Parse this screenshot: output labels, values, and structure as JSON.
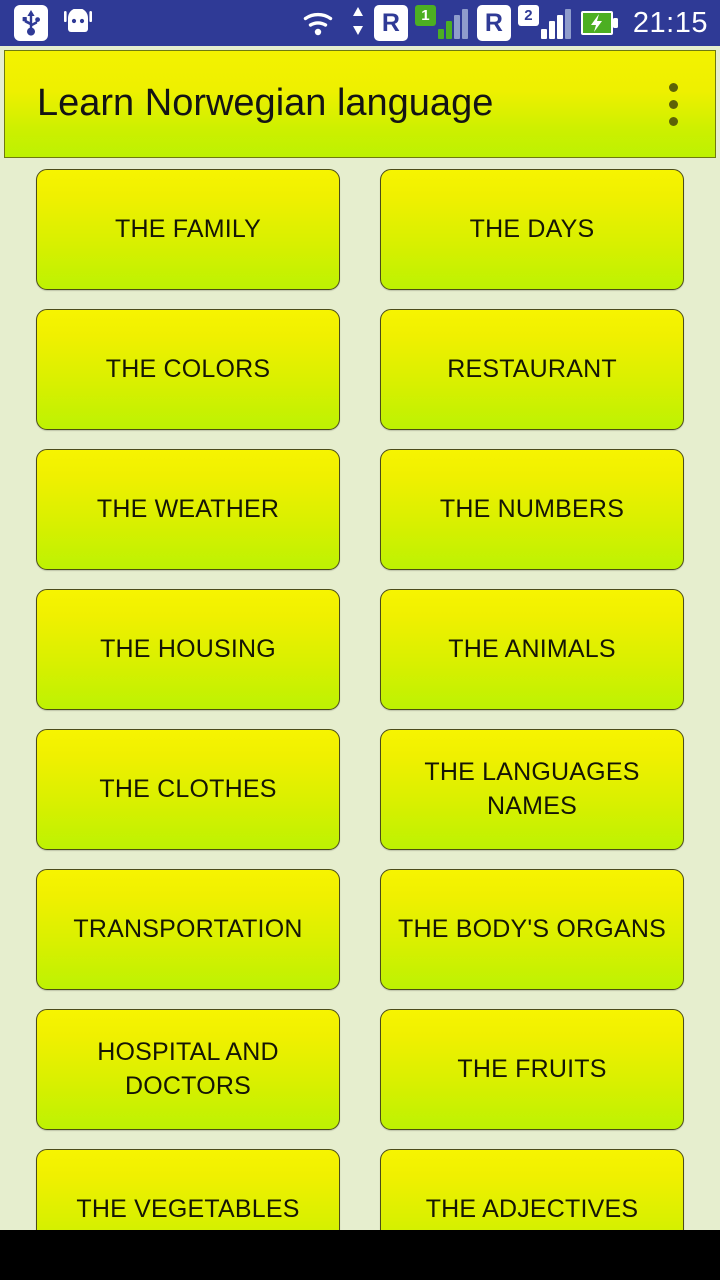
{
  "status_bar": {
    "usb_icon": "usb-icon",
    "android_icon": "android-robot-icon",
    "wifi_icon": "wifi-icon",
    "data_arrows_icon": "data-transfer-arrows-icon",
    "sim1_roaming_label": "R",
    "sim1_badge": "1",
    "sim2_roaming_label": "R",
    "sim2_badge": "2",
    "battery_icon": "battery-charging-icon",
    "time": "21:15",
    "background_color": "#2f3a96"
  },
  "action_bar": {
    "title": "Learn Norwegian language",
    "overflow_icon": "overflow-menu-icon",
    "gradient_top_color": "#f4f200",
    "gradient_bottom_color": "#bdf202"
  },
  "page": {
    "background_color": "#e6eece",
    "tile_border_color": "#4c4c18",
    "tile_text_color": "#151505"
  },
  "grid": {
    "tiles": [
      {
        "label": "THE FAMILY"
      },
      {
        "label": "THE DAYS"
      },
      {
        "label": "THE COLORS"
      },
      {
        "label": "RESTAURANT"
      },
      {
        "label": "THE WEATHER"
      },
      {
        "label": "THE NUMBERS"
      },
      {
        "label": "THE HOUSING"
      },
      {
        "label": "THE ANIMALS"
      },
      {
        "label": "THE CLOTHES"
      },
      {
        "label": "THE LANGUAGES NAMES"
      },
      {
        "label": "TRANSPORTATION"
      },
      {
        "label": "THE BODY'S ORGANS"
      },
      {
        "label": "HOSPITAL AND DOCTORS"
      },
      {
        "label": "THE FRUITS"
      },
      {
        "label": "THE VEGETABLES"
      },
      {
        "label": "THE ADJECTIVES"
      }
    ]
  }
}
